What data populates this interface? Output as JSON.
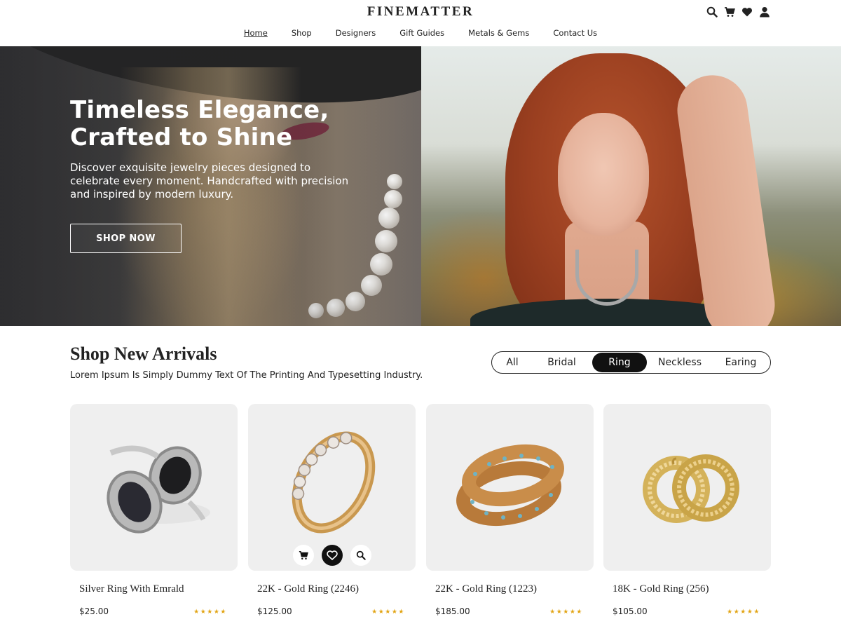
{
  "brand": {
    "logo": "FINEMATTER"
  },
  "header": {
    "icons": [
      "search-icon",
      "cart-icon",
      "heart-icon",
      "user-icon"
    ],
    "nav": [
      {
        "label": "Home",
        "active": true
      },
      {
        "label": "Shop",
        "active": false
      },
      {
        "label": "Designers",
        "active": false
      },
      {
        "label": "Gift Guides",
        "active": false
      },
      {
        "label": "Metals & Gems",
        "active": false
      },
      {
        "label": "Contact Us",
        "active": false
      }
    ]
  },
  "hero": {
    "title": "Timeless Elegance, Crafted to Shine",
    "subtitle": "Discover exquisite jewelry pieces designed to celebrate every moment. Handcrafted with precision and inspired by modern luxury.",
    "cta": "SHOP NOW"
  },
  "arrivals": {
    "title": "Shop New Arrivals",
    "subtitle": "Lorem Ipsum Is Simply Dummy Text Of The Printing And Typesetting Industry.",
    "filters": [
      {
        "label": "All",
        "active": false
      },
      {
        "label": "Bridal",
        "active": false
      },
      {
        "label": "Ring",
        "active": true
      },
      {
        "label": "Neckless",
        "active": false
      },
      {
        "label": "Earing",
        "active": false
      }
    ],
    "products": [
      {
        "name": "Silver Ring With Emrald",
        "price": "$25.00",
        "rating": 5
      },
      {
        "name": "22K - Gold Ring (2246)",
        "price": "$125.00",
        "rating": 5,
        "hover_actions": [
          "cart-icon",
          "heart-icon",
          "search-icon"
        ]
      },
      {
        "name": "22K - Gold Ring (1223)",
        "price": "$185.00",
        "rating": 5
      },
      {
        "name": "18K - Gold Ring (256)",
        "price": "$105.00",
        "rating": 5
      }
    ]
  },
  "colors": {
    "accent": "#111111",
    "star": "#e2a516",
    "card_bg": "#efefef"
  }
}
